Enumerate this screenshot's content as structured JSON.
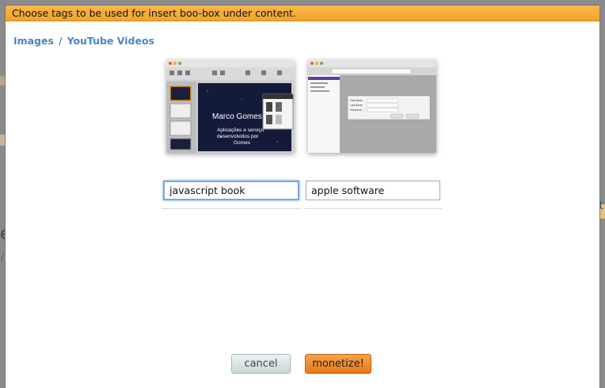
{
  "modal": {
    "title": "Choose tags to be used for insert boo-box under content."
  },
  "breadcrumb": {
    "images": "Images",
    "separator": "/",
    "videos": "YouTube Videos"
  },
  "thumbnails": [
    {
      "presentation_title": "Marco Gomes",
      "presentation_subtitle_1": "Aplicações e serviço",
      "presentation_subtitle_2": "desenvolvidos por",
      "presentation_subtitle_3": "Gomes"
    },
    {
      "form_field_1": "First Name:",
      "form_field_2": "Last Name:",
      "form_field_3": "Telephone:"
    }
  ],
  "tags": [
    {
      "value": "javascript book"
    },
    {
      "value": "apple software"
    }
  ],
  "actions": {
    "cancel_label": "cancel",
    "monetize_label": "monetize!"
  },
  "colors": {
    "title_bar": "#f3a32e",
    "link": "#4a86c0",
    "monetize": "#e8781c"
  }
}
